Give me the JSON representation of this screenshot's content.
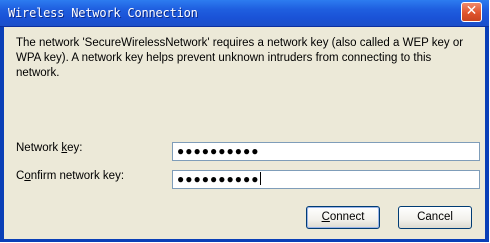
{
  "window": {
    "title": "Wireless Network Connection",
    "close_glyph": "✕"
  },
  "message": "The network 'SecureWirelessNetwork' requires a network key (also called a WEP key or WPA key). A network key helps prevent unknown intruders from connecting to this network.",
  "fields": {
    "network_key": {
      "label_pre": "Network ",
      "label_accel": "k",
      "label_post": "ey:",
      "value": "●●●●●●●●●●"
    },
    "confirm_key": {
      "label_pre": "C",
      "label_accel": "o",
      "label_post": "nfirm network key:",
      "value": "●●●●●●●●●●"
    }
  },
  "buttons": {
    "connect": {
      "accel": "C",
      "rest": "onnect"
    },
    "cancel": {
      "label": "Cancel"
    }
  },
  "colors": {
    "titlebar": "#1f5fe0",
    "frame": "#0a3fb7",
    "dialog_face": "#ece9d8",
    "close_button": "#e0542d",
    "field_border": "#7f9db9"
  }
}
